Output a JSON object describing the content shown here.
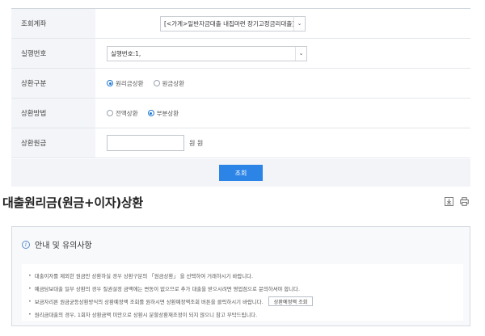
{
  "form": {
    "rows": [
      {
        "label": "조회계좌"
      },
      {
        "label": "실행번호"
      },
      {
        "label": "상환구분"
      },
      {
        "label": "상환방법"
      },
      {
        "label": "상환원금"
      }
    ],
    "account_select_value": "[<가계>일반자금대출 내집마련 장기고정금리대출]",
    "exec_select_value": "실행번호:1,",
    "repayment_type_options": [
      {
        "label": "원리금상환",
        "selected": true
      },
      {
        "label": "원금상환",
        "selected": false
      }
    ],
    "repayment_method_options": [
      {
        "label": "전액상환",
        "selected": false
      },
      {
        "label": "부분상환",
        "selected": true
      }
    ],
    "amount_value": "",
    "amount_unit": "원 원",
    "submit_label": "조회"
  },
  "page": {
    "title": "대출원리금(원금+이자)상환"
  },
  "icons": {
    "download": "download-icon",
    "print": "print-icon",
    "info": "info-icon"
  },
  "notice": {
    "title": "안내 및 유의사항",
    "items": [
      "대출이자를 제외한 원금만 상환하실 경우 상환구분의 「원금상환」 을 선택하여 거래하시기 바랍니다.",
      "예금담보대출 일부 상환의 경우 질권설정 금액에는 변동이 없으므로 추가 대출을 받으시려면 영업점으로 문의하셔야 합니다.",
      "보금자리론 원금균등상환방식의 상환예정액 조회를 원하시면 상환예정액조회 버튼을 클릭하시기 바랍니다.",
      "원리금대출의 경우, 1회차 상환금액 미만으로 상환시 분할상환재조정이 되지 않으니 참고 부탁드립니다."
    ],
    "schedule_button_label": "상환예정액 조회"
  },
  "colors": {
    "primary": "#2b84e6",
    "radio_on": "#1f78d1",
    "header_bg": "#f3f5f8"
  }
}
